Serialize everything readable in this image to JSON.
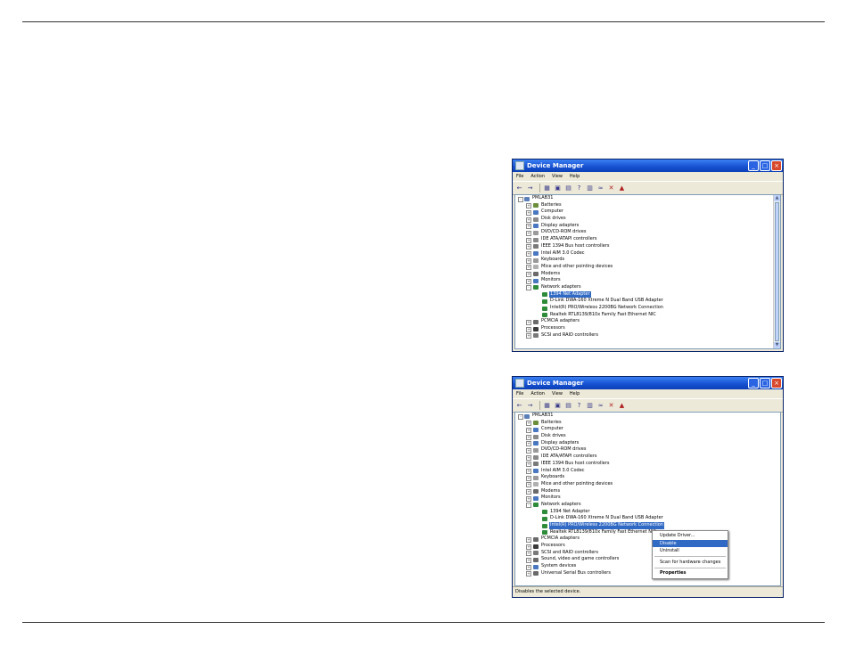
{
  "window1": {
    "title": "Device Manager",
    "menu": [
      "File",
      "Action",
      "View",
      "Help"
    ],
    "toolbar_icons": [
      "back-arrow-icon",
      "forward-arrow-icon",
      "show-hide-tree-icon",
      "properties-icon",
      "print-icon",
      "help-icon",
      "update-driver-icon",
      "scan-hardware-icon",
      "disable-device-icon",
      "uninstall-device-icon"
    ],
    "root": "PMLAB31",
    "nodes": [
      {
        "label": "Batteries",
        "depth": 1,
        "exp": "+",
        "icon": "#6b8e3a"
      },
      {
        "label": "Computer",
        "depth": 1,
        "exp": "+",
        "icon": "#4a78c0"
      },
      {
        "label": "Disk drives",
        "depth": 1,
        "exp": "+",
        "icon": "#8a8a8a"
      },
      {
        "label": "Display adapters",
        "depth": 1,
        "exp": "+",
        "icon": "#4a78c0"
      },
      {
        "label": "DVD/CD-ROM drives",
        "depth": 1,
        "exp": "+",
        "icon": "#9a9a9a"
      },
      {
        "label": "IDE ATA/ATAPI controllers",
        "depth": 1,
        "exp": "+",
        "icon": "#8a8a8a"
      },
      {
        "label": "IEEE 1394 Bus host controllers",
        "depth": 1,
        "exp": "+",
        "icon": "#7a7a7a"
      },
      {
        "label": "Intel AIM 3.0 Codec",
        "depth": 1,
        "exp": "+",
        "icon": "#4a78c0"
      },
      {
        "label": "Keyboards",
        "depth": 1,
        "exp": "+",
        "icon": "#9a9a9a"
      },
      {
        "label": "Mice and other pointing devices",
        "depth": 1,
        "exp": "+",
        "icon": "#b0b0b0"
      },
      {
        "label": "Modems",
        "depth": 1,
        "exp": "+",
        "icon": "#6a6a6a"
      },
      {
        "label": "Monitors",
        "depth": 1,
        "exp": "+",
        "icon": "#4a78c0"
      },
      {
        "label": "Network adapters",
        "depth": 1,
        "exp": "-",
        "icon": "#2e8b3a"
      },
      {
        "label": "1394 Net Adapter",
        "depth": 2,
        "exp": "",
        "icon": "#2e8b3a",
        "selected": true
      },
      {
        "label": "D-Link DWA-160 Xtreme N Dual Band USB Adapter",
        "depth": 2,
        "exp": "",
        "icon": "#2e8b3a"
      },
      {
        "label": "Intel(R) PRO/Wireless 2200BG Network Connection",
        "depth": 2,
        "exp": "",
        "icon": "#2e8b3a"
      },
      {
        "label": "Realtek RTL8139/810x Family Fast Ethernet NIC",
        "depth": 2,
        "exp": "",
        "icon": "#2e8b3a"
      },
      {
        "label": "PCMCIA adapters",
        "depth": 1,
        "exp": "+",
        "icon": "#6a6a6a"
      },
      {
        "label": "Processors",
        "depth": 1,
        "exp": "+",
        "icon": "#3a3a3a"
      },
      {
        "label": "SCSI and RAID controllers",
        "depth": 1,
        "exp": "+",
        "icon": "#7a7a7a"
      }
    ]
  },
  "window2": {
    "title": "Device Manager",
    "menu": [
      "File",
      "Action",
      "View",
      "Help"
    ],
    "toolbar_icons": [
      "back-arrow-icon",
      "forward-arrow-icon",
      "show-hide-tree-icon",
      "properties-icon",
      "print-icon",
      "help-icon",
      "update-driver-icon",
      "scan-hardware-icon",
      "disable-device-icon",
      "uninstall-device-icon"
    ],
    "root": "PMLAB31",
    "nodes": [
      {
        "label": "Batteries",
        "depth": 1,
        "exp": "+",
        "icon": "#6b8e3a"
      },
      {
        "label": "Computer",
        "depth": 1,
        "exp": "+",
        "icon": "#4a78c0"
      },
      {
        "label": "Disk drives",
        "depth": 1,
        "exp": "+",
        "icon": "#8a8a8a"
      },
      {
        "label": "Display adapters",
        "depth": 1,
        "exp": "+",
        "icon": "#4a78c0"
      },
      {
        "label": "DVD/CD-ROM drives",
        "depth": 1,
        "exp": "+",
        "icon": "#9a9a9a"
      },
      {
        "label": "IDE ATA/ATAPI controllers",
        "depth": 1,
        "exp": "+",
        "icon": "#8a8a8a"
      },
      {
        "label": "IEEE 1394 Bus host controllers",
        "depth": 1,
        "exp": "+",
        "icon": "#7a7a7a"
      },
      {
        "label": "Intel AIM 3.0 Codec",
        "depth": 1,
        "exp": "+",
        "icon": "#4a78c0"
      },
      {
        "label": "Keyboards",
        "depth": 1,
        "exp": "+",
        "icon": "#9a9a9a"
      },
      {
        "label": "Mice and other pointing devices",
        "depth": 1,
        "exp": "+",
        "icon": "#b0b0b0"
      },
      {
        "label": "Modems",
        "depth": 1,
        "exp": "+",
        "icon": "#6a6a6a"
      },
      {
        "label": "Monitors",
        "depth": 1,
        "exp": "+",
        "icon": "#4a78c0"
      },
      {
        "label": "Network adapters",
        "depth": 1,
        "exp": "-",
        "icon": "#2e8b3a"
      },
      {
        "label": "1394 Net Adapter",
        "depth": 2,
        "exp": "",
        "icon": "#2e8b3a"
      },
      {
        "label": "D-Link DWA-160 Xtreme N Dual Band USB Adapter",
        "depth": 2,
        "exp": "",
        "icon": "#2e8b3a"
      },
      {
        "label": "Intel(R) PRO/Wireless 2200BG Network Connection",
        "depth": 2,
        "exp": "",
        "icon": "#2e8b3a",
        "selected": true
      },
      {
        "label": "Realtek RTL8139/810x Family Fast Ethernet NIC",
        "depth": 2,
        "exp": "",
        "icon": "#2e8b3a"
      },
      {
        "label": "PCMCIA adapters",
        "depth": 1,
        "exp": "+",
        "icon": "#6a6a6a"
      },
      {
        "label": "Processors",
        "depth": 1,
        "exp": "+",
        "icon": "#3a3a3a"
      },
      {
        "label": "SCSI and RAID controllers",
        "depth": 1,
        "exp": "+",
        "icon": "#7a7a7a"
      },
      {
        "label": "Sound, video and game controllers",
        "depth": 1,
        "exp": "+",
        "icon": "#6a6a6a"
      },
      {
        "label": "System devices",
        "depth": 1,
        "exp": "+",
        "icon": "#4a78c0"
      },
      {
        "label": "Universal Serial Bus controllers",
        "depth": 1,
        "exp": "+",
        "icon": "#6a6a6a"
      }
    ],
    "context_menu": {
      "update_driver": "Update Driver...",
      "disable": "Disable",
      "uninstall": "Uninstall",
      "scan": "Scan for hardware changes",
      "properties": "Properties"
    },
    "status_text": "Disables the selected device."
  }
}
